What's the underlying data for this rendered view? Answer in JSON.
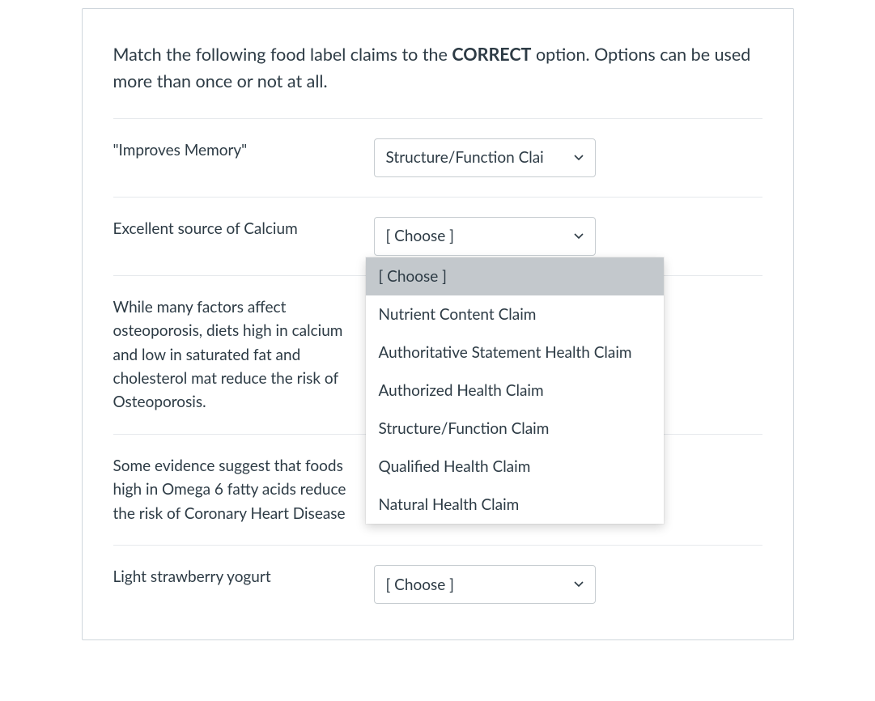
{
  "question": {
    "prompt_pre": "Match the following food label claims to the ",
    "prompt_bold": "CORRECT",
    "prompt_post": " option.  Options can be used more than once or not at all."
  },
  "rows": [
    {
      "label": "\"Improves Memory\"",
      "selected": "Structure/Function Clai"
    },
    {
      "label": "Excellent source of Calcium",
      "selected": "[ Choose ]"
    },
    {
      "label": "While many factors affect osteoporosis, diets high in calcium and low in saturated fat and cholesterol mat reduce the risk of Osteoporosis.",
      "selected": ""
    },
    {
      "label": "Some evidence suggest that foods high in Omega 6 fatty acids reduce the risk of Coronary Heart Disease",
      "selected": ""
    },
    {
      "label": "Light strawberry yogurt",
      "selected": "[ Choose ]"
    }
  ],
  "dropdown": {
    "options": [
      "[ Choose ]",
      "Nutrient Content Claim",
      "Authoritative Statement Health Claim",
      "Authorized Health Claim",
      "Structure/Function Claim",
      "Qualified Health Claim",
      "Natural Health Claim"
    ],
    "highlight_index": 0
  }
}
